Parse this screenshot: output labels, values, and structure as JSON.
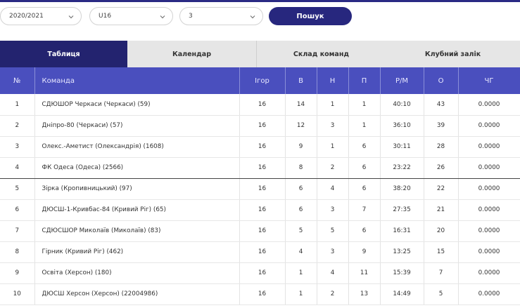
{
  "filters": {
    "season": "2020/2021",
    "age_group": "U16",
    "division": "3",
    "search_label": "Пошук"
  },
  "tabs": [
    {
      "label": "Таблиця",
      "active": true
    },
    {
      "label": "Календар",
      "active": false
    },
    {
      "label": "Склад команд",
      "active": false
    },
    {
      "label": "Клубний залік",
      "active": false
    }
  ],
  "table": {
    "headers": [
      "№",
      "Команда",
      "Ігор",
      "В",
      "Н",
      "П",
      "Р/М",
      "О",
      "ЧГ"
    ],
    "rows": [
      [
        "1",
        "СДЮШОР Черкаси (Черкаси) (59)",
        "16",
        "14",
        "1",
        "1",
        "40:10",
        "43",
        "0.0000"
      ],
      [
        "2",
        "Дніпро-80 (Черкаси) (57)",
        "16",
        "12",
        "3",
        "1",
        "36:10",
        "39",
        "0.0000"
      ],
      [
        "3",
        "Олекс.-Аметист (Олександрія) (1608)",
        "16",
        "9",
        "1",
        "6",
        "30:11",
        "28",
        "0.0000"
      ],
      [
        "4",
        "ФК Одеса (Одеса) (2566)",
        "16",
        "8",
        "2",
        "6",
        "23:22",
        "26",
        "0.0000"
      ],
      [
        "5",
        "Зірка (Кропивницький) (97)",
        "16",
        "6",
        "4",
        "6",
        "38:20",
        "22",
        "0.0000"
      ],
      [
        "6",
        "ДЮСШ-1-Кривбас-84 (Кривий Ріг) (65)",
        "16",
        "6",
        "3",
        "7",
        "27:35",
        "21",
        "0.0000"
      ],
      [
        "7",
        "СДЮСШОР Миколаїв (Миколаїв) (83)",
        "16",
        "5",
        "5",
        "6",
        "16:31",
        "20",
        "0.0000"
      ],
      [
        "8",
        "Гірник (Кривий Ріг) (462)",
        "16",
        "4",
        "3",
        "9",
        "13:25",
        "15",
        "0.0000"
      ],
      [
        "9",
        "Освіта (Херсон) (180)",
        "16",
        "1",
        "4",
        "11",
        "15:39",
        "7",
        "0.0000"
      ],
      [
        "10",
        "ДЮСШ Херсон (Херсон) (22004986)",
        "16",
        "1",
        "2",
        "13",
        "14:49",
        "5",
        "0.0000"
      ]
    ]
  }
}
